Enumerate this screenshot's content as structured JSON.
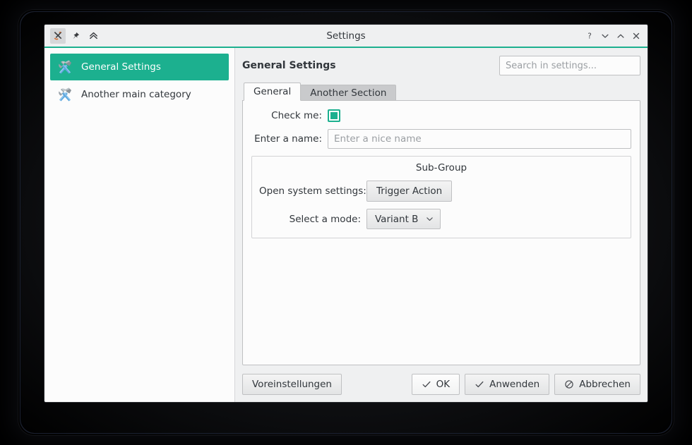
{
  "window": {
    "title": "Settings",
    "accent_color": "#1cb08f",
    "titlebar_left_icons": [
      {
        "name": "app-menu-icon",
        "glyph": "X"
      },
      {
        "name": "pin-icon",
        "glyph": "pin"
      },
      {
        "name": "shade-icon",
        "glyph": "chevrons-up"
      }
    ],
    "titlebar_right_icons": [
      {
        "name": "help-icon",
        "glyph": "?"
      },
      {
        "name": "minimize-icon",
        "glyph": "chevron-down"
      },
      {
        "name": "maximize-icon",
        "glyph": "chevron-up"
      },
      {
        "name": "close-icon",
        "glyph": "x"
      }
    ]
  },
  "sidebar": {
    "items": [
      {
        "label": "General Settings",
        "icon": "tools-icon",
        "selected": true
      },
      {
        "label": "Another main category",
        "icon": "tools-icon",
        "selected": false
      }
    ]
  },
  "pane": {
    "title": "General Settings",
    "search": {
      "placeholder": "Search in settings...",
      "value": ""
    },
    "tabs": [
      {
        "label": "General",
        "active": true
      },
      {
        "label": "Another Section",
        "active": false
      }
    ],
    "form": {
      "checkbox_label": "Check me:",
      "checkbox_state": "partially-checked",
      "name_label": "Enter a name:",
      "name_placeholder": "Enter a nice name",
      "name_value": ""
    },
    "group": {
      "title": "Sub-Group",
      "action_label": "Open system settings:",
      "action_button": "Trigger Action",
      "mode_label": "Select a mode:",
      "mode_value": "Variant B"
    }
  },
  "footer": {
    "defaults": "Voreinstellungen",
    "ok": "OK",
    "apply": "Anwenden",
    "cancel": "Abbrechen"
  }
}
